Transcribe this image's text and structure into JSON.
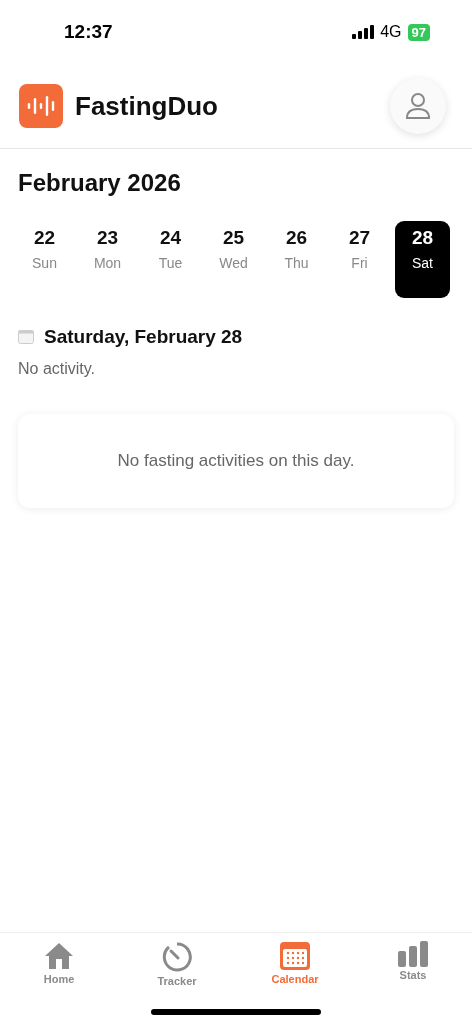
{
  "status_bar": {
    "time": "12:37",
    "network": "4G",
    "battery": "97"
  },
  "header": {
    "app_name": "FastingDuo"
  },
  "month_title": "February 2026",
  "days": [
    {
      "date": "22",
      "weekday": "Sun",
      "selected": false
    },
    {
      "date": "23",
      "weekday": "Mon",
      "selected": false
    },
    {
      "date": "24",
      "weekday": "Tue",
      "selected": false
    },
    {
      "date": "25",
      "weekday": "Wed",
      "selected": false
    },
    {
      "date": "26",
      "weekday": "Thu",
      "selected": false
    },
    {
      "date": "27",
      "weekday": "Fri",
      "selected": false
    },
    {
      "date": "28",
      "weekday": "Sat",
      "selected": true
    }
  ],
  "day_heading": "Saturday, February 28",
  "day_summary": "No activity.",
  "empty_card": "No fasting activities on this day.",
  "tab_bar": [
    {
      "kind": "home",
      "label": "Home",
      "selected": false
    },
    {
      "kind": "tracker",
      "label": "Tracker",
      "selected": false
    },
    {
      "kind": "calendar",
      "label": "Calendar",
      "selected": true
    },
    {
      "kind": "stats",
      "label": "Stats",
      "selected": false
    }
  ]
}
